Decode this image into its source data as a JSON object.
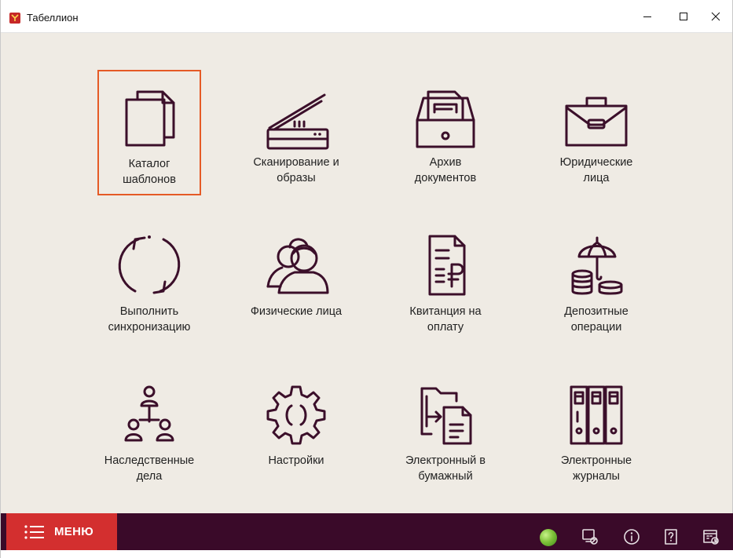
{
  "window": {
    "title": "Табеллион",
    "controls": {
      "minimize": "—",
      "maximize": "☐",
      "close": "✕"
    }
  },
  "tiles": [
    {
      "label": "Каталог\nшаблонов",
      "icon": "documents-icon",
      "selected": true
    },
    {
      "label": "Сканирование и\nобразы",
      "icon": "scanner-icon",
      "selected": false
    },
    {
      "label": "Архив\nдокументов",
      "icon": "archive-drawer-icon",
      "selected": false
    },
    {
      "label": "Юридические\nлица",
      "icon": "briefcase-icon",
      "selected": false
    },
    {
      "label": "Выполнить\nсинхронизацию",
      "icon": "sync-icon",
      "selected": false
    },
    {
      "label": "Физические лица",
      "icon": "people-icon",
      "selected": false
    },
    {
      "label": "Квитанция на\nоплату",
      "icon": "ruble-receipt-icon",
      "selected": false
    },
    {
      "label": "Депозитные\nоперации",
      "icon": "umbrella-coins-icon",
      "selected": false
    },
    {
      "label": "Наследственные\nдела",
      "icon": "family-tree-icon",
      "selected": false
    },
    {
      "label": "Настройки",
      "icon": "gear-icon",
      "selected": false
    },
    {
      "label": "Электронный в\nбумажный",
      "icon": "folder-to-document-icon",
      "selected": false
    },
    {
      "label": "Электронные\nжурналы",
      "icon": "binders-icon",
      "selected": false
    }
  ],
  "bottombar": {
    "menu_label": "МЕНЮ",
    "status": "online",
    "icons": [
      "screen-settings-icon",
      "info-icon",
      "help-icon",
      "calendar-icon"
    ]
  },
  "colors": {
    "accent": "#3b0f2a",
    "menu_red": "#d32f2f",
    "selection": "#e55a26",
    "background": "#efebe4"
  }
}
